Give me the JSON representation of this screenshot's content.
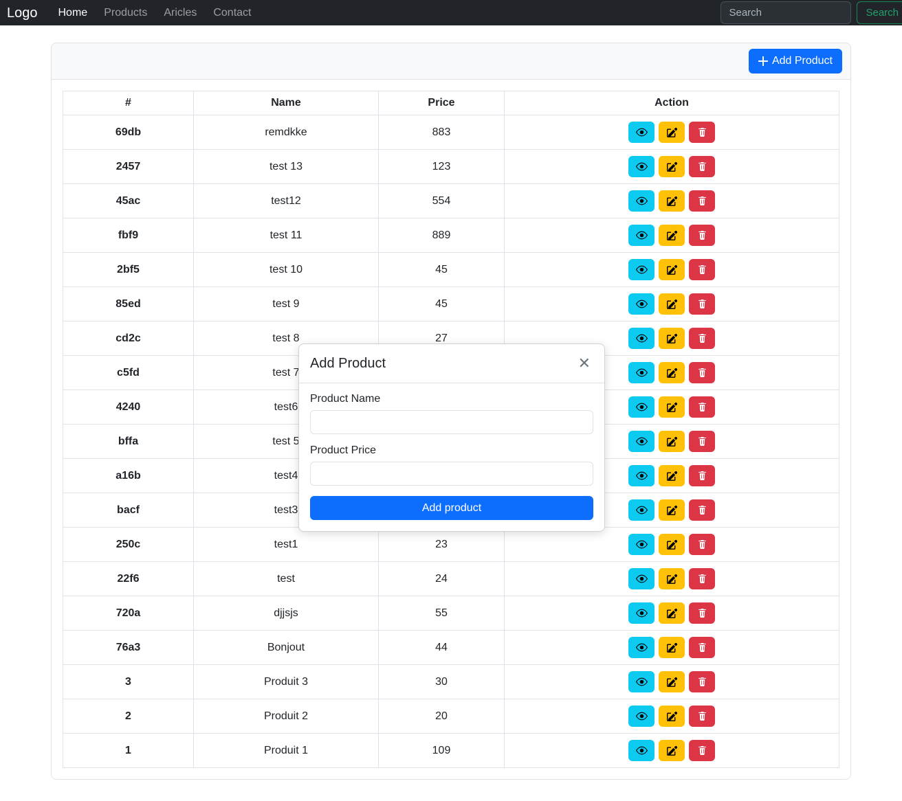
{
  "navbar": {
    "brand": "Logo",
    "links": [
      {
        "label": "Home",
        "active": true
      },
      {
        "label": "Products",
        "active": false
      },
      {
        "label": "Aricles",
        "active": false
      },
      {
        "label": "Contact",
        "active": false
      }
    ],
    "search": {
      "value": "",
      "placeholder": "Search",
      "button_label": "Search"
    },
    "colors": {
      "background": "#212529",
      "search_button": "#198754"
    }
  },
  "card": {
    "add_product_button": "Add Product",
    "add_icon": "plus-icon"
  },
  "table": {
    "headers": [
      "#",
      "Name",
      "Price",
      "Action"
    ],
    "row_actions": {
      "view": "eye-icon",
      "edit": "pencil-square-icon",
      "delete": "trash-icon"
    },
    "rows": [
      {
        "id": "69db",
        "name": "remdkke",
        "price": "883"
      },
      {
        "id": "2457",
        "name": "test 13",
        "price": "123"
      },
      {
        "id": "45ac",
        "name": "test12",
        "price": "554"
      },
      {
        "id": "fbf9",
        "name": "test 11",
        "price": "889"
      },
      {
        "id": "2bf5",
        "name": "test 10",
        "price": "45"
      },
      {
        "id": "85ed",
        "name": "test 9",
        "price": "45"
      },
      {
        "id": "cd2c",
        "name": "test 8",
        "price": "27"
      },
      {
        "id": "c5fd",
        "name": "test 7",
        "price": ""
      },
      {
        "id": "4240",
        "name": "test6",
        "price": ""
      },
      {
        "id": "bffa",
        "name": "test 5",
        "price": ""
      },
      {
        "id": "a16b",
        "name": "test4",
        "price": ""
      },
      {
        "id": "bacf",
        "name": "test3",
        "price": ""
      },
      {
        "id": "250c",
        "name": "test1",
        "price": "23"
      },
      {
        "id": "22f6",
        "name": "test",
        "price": "24"
      },
      {
        "id": "720a",
        "name": "djjsjs",
        "price": "55"
      },
      {
        "id": "76a3",
        "name": "Bonjout",
        "price": "44"
      },
      {
        "id": "3",
        "name": "Produit 3",
        "price": "30"
      },
      {
        "id": "2",
        "name": "Produit 2",
        "price": "20"
      },
      {
        "id": "1",
        "name": "Produit 1",
        "price": "109"
      }
    ]
  },
  "modal": {
    "title": "Add Product",
    "close_icon": "close-icon",
    "name_label": "Product Name",
    "name_value": "",
    "price_label": "Product Price",
    "price_value": "",
    "submit_label": "Add product"
  },
  "colors": {
    "primary": "#0d6efd",
    "view": "#0dcaf0",
    "edit": "#ffc107",
    "delete": "#dc3545"
  }
}
